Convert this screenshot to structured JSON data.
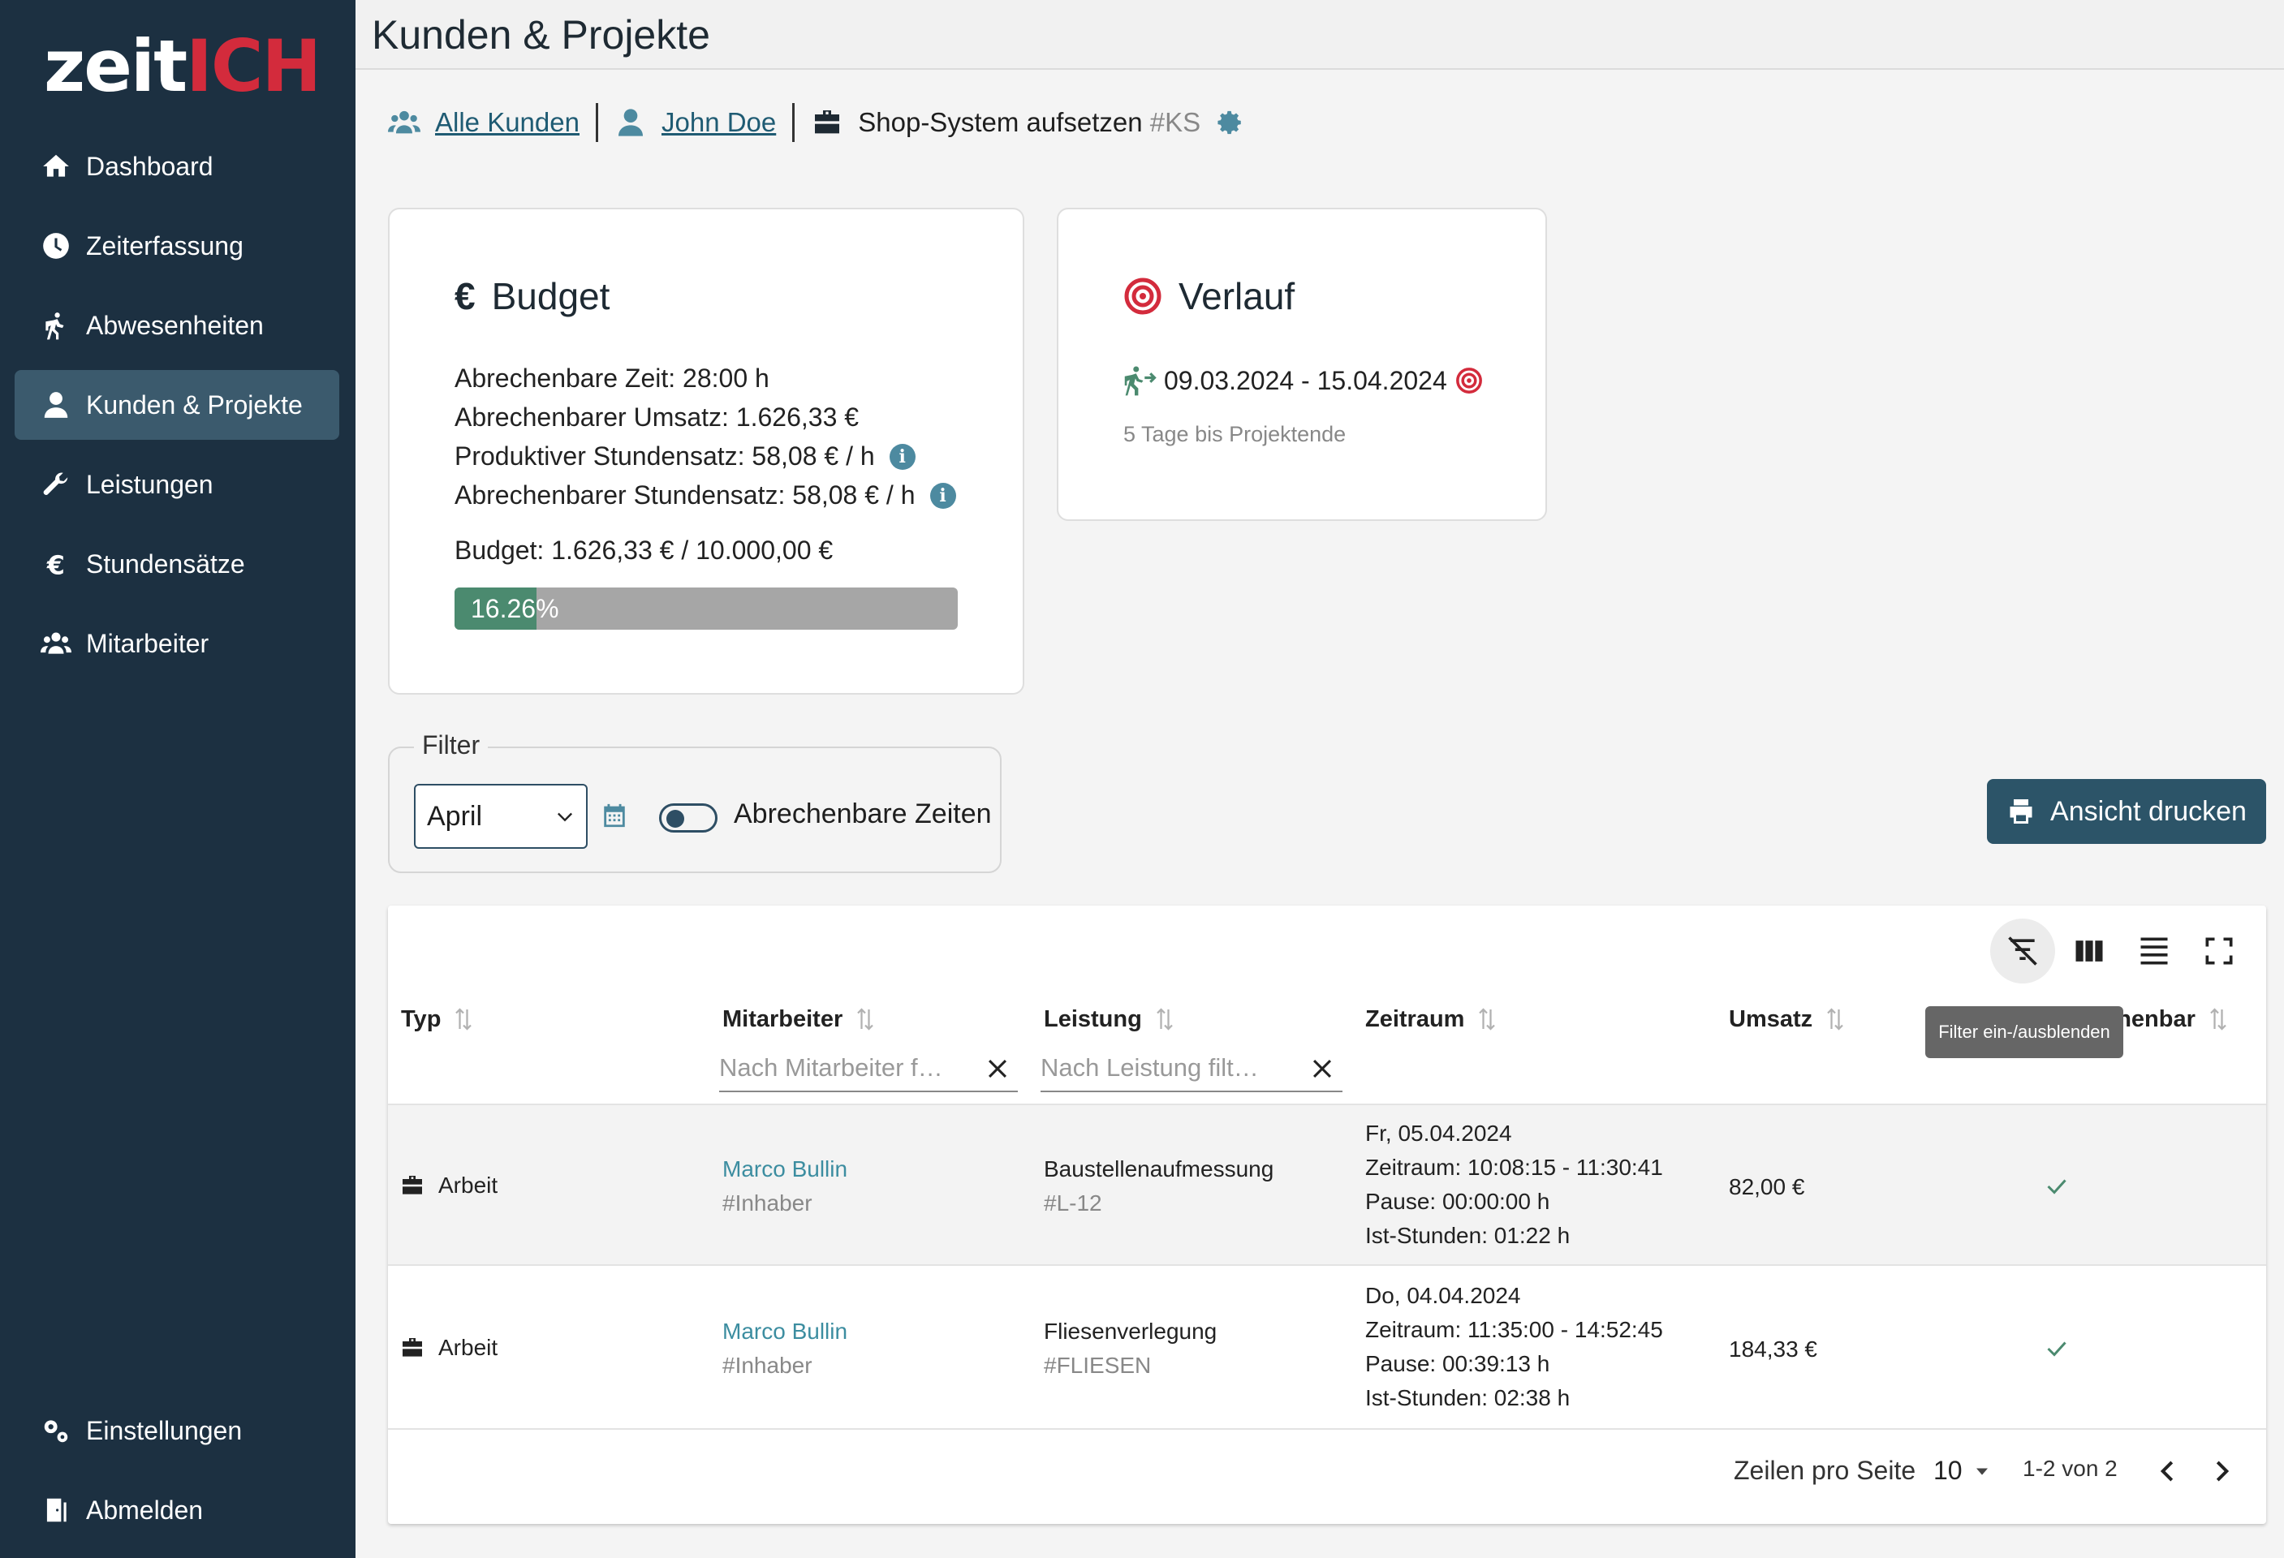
{
  "app": {
    "logo_text": "zeit",
    "logo_accent": "ICH",
    "accent_color": "#d32b3c",
    "sidebar_color": "#1c3041",
    "primary_color": "#2c5468"
  },
  "sidebar": {
    "items": [
      {
        "label": "Dashboard",
        "icon": "home-icon"
      },
      {
        "label": "Zeiterfassung",
        "icon": "clock-icon"
      },
      {
        "label": "Abwesenheiten",
        "icon": "walking-icon"
      },
      {
        "label": "Kunden & Projekte",
        "icon": "user-icon",
        "active": true
      },
      {
        "label": "Leistungen",
        "icon": "wrench-icon"
      },
      {
        "label": "Stundensätze",
        "icon": "euro-icon"
      },
      {
        "label": "Mitarbeiter",
        "icon": "users-icon"
      }
    ],
    "bottom_items": [
      {
        "label": "Einstellungen",
        "icon": "gears-icon"
      },
      {
        "label": "Abmelden",
        "icon": "door-icon"
      }
    ]
  },
  "header": {
    "title": "Kunden & Projekte"
  },
  "breadcrumb": {
    "all_customers": "Alle Kunden",
    "customer": "John Doe",
    "project": "Shop-System aufsetzen",
    "project_code": "#KS"
  },
  "budget_card": {
    "title": "Budget",
    "lines": [
      "Abrechenbare Zeit: 28:00 h",
      "Abrechenbarer Umsatz: 1.626,33 €",
      "Produktiver Stundensatz: 58,08 € / h",
      "Abrechenbarer Stundensatz: 58,08 € / h"
    ],
    "budget_line": "Budget: 1.626,33 € / 10.000,00 €",
    "progress_label": "16.26%",
    "progress_value": 0.1626
  },
  "verlauf_card": {
    "title": "Verlauf",
    "date_range": "09.03.2024 - 15.04.2024",
    "remaining": "5 Tage bis Projektende"
  },
  "filter": {
    "legend": "Filter",
    "month": "April",
    "toggle_label": "Abrechenbare Zeiten",
    "toggle_on": false
  },
  "print_button": {
    "label": "Ansicht drucken"
  },
  "table": {
    "tooltip": "Filter ein-/ausblenden",
    "columns": [
      "Typ",
      "Mitarbeiter",
      "Leistung",
      "Zeitraum",
      "Umsatz",
      "Abrechenbar"
    ],
    "filters": {
      "mitarbeiter": "Nach Mitarbeiter f…",
      "leistung": "Nach Leistung filt…"
    },
    "rows": [
      {
        "typ": "Arbeit",
        "mitarbeiter": "Marco Bullin",
        "mitarbeiter_role": "#Inhaber",
        "leistung": "Baustellenaufmessung",
        "leistung_code": "#L-12",
        "zeitraum": [
          "Fr, 05.04.2024",
          "Zeitraum: 10:08:15 - 11:30:41",
          "Pause: 00:00:00 h",
          "Ist-Stunden: 01:22 h"
        ],
        "umsatz": "82,00 €",
        "abrechenbar": true
      },
      {
        "typ": "Arbeit",
        "mitarbeiter": "Marco Bullin",
        "mitarbeiter_role": "#Inhaber",
        "leistung": "Fliesenverlegung",
        "leistung_code": "#FLIESEN",
        "zeitraum": [
          "Do, 04.04.2024",
          "Zeitraum: 11:35:00 - 14:52:45",
          "Pause: 00:39:13 h",
          "Ist-Stunden: 02:38 h"
        ],
        "umsatz": "184,33 €",
        "abrechenbar": true
      }
    ],
    "pagination": {
      "rows_label": "Zeilen pro Seite",
      "rows_value": "10",
      "range": "1-2 von 2"
    }
  }
}
